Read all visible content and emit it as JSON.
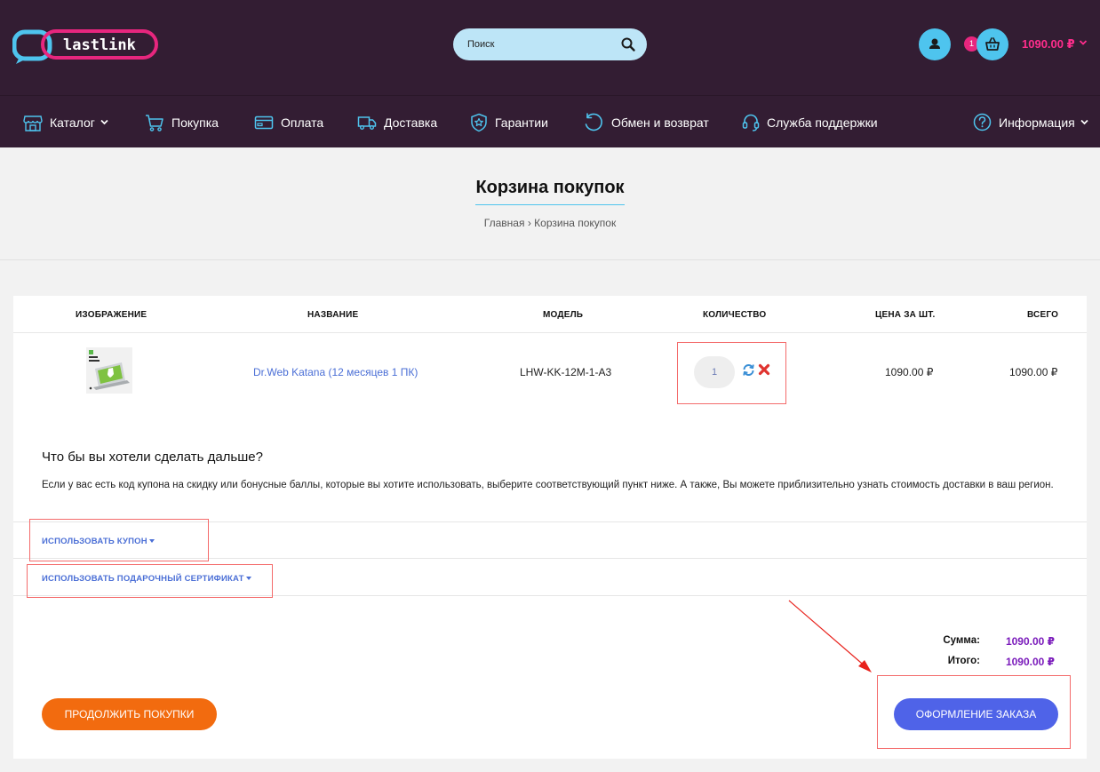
{
  "header": {
    "logo_text": "lastlink",
    "search_placeholder": "Поиск",
    "cart_count": "1",
    "cart_total": "1090.00 ₽"
  },
  "nav": [
    {
      "label": "Каталог",
      "icon": "storefront-icon",
      "has_dropdown": true
    },
    {
      "label": "Покупка",
      "icon": "cart-icon"
    },
    {
      "label": "Оплата",
      "icon": "credit-card-icon"
    },
    {
      "label": "Доставка",
      "icon": "truck-icon"
    },
    {
      "label": "Гарантии",
      "icon": "shield-star-icon"
    },
    {
      "label": "Обмен и возврат",
      "icon": "return-icon"
    },
    {
      "label": "Служба поддержки",
      "icon": "headset-icon"
    },
    {
      "label": "Информация",
      "icon": "question-icon",
      "has_dropdown": true
    }
  ],
  "page": {
    "title": "Корзина покупок",
    "breadcrumb_home": "Главная",
    "breadcrumb_sep": "›",
    "breadcrumb_current": "Корзина покупок"
  },
  "table": {
    "headers": [
      "Изображение",
      "Название",
      "Модель",
      "Количество",
      "Цена за шт.",
      "Всего"
    ],
    "rows": [
      {
        "name": "Dr.Web Katana (12 месяцев 1 ПК)",
        "model": "LHW-KK-12M-1-A3",
        "quantity": "1",
        "unit_price": "1090.00 ₽",
        "total": "1090.00 ₽"
      }
    ]
  },
  "next_steps": {
    "title": "Что бы вы хотели сделать дальше?",
    "text": "Если у вас есть код купона на скидку или бонусные баллы, которые вы хотите использовать, выберите соответствующий пункт ниже. А также, Вы можете приблизительно узнать стоимость доставки в ваш регион.",
    "coupon_label": "Использовать купон",
    "gift_label": "Использовать подарочный сертификат"
  },
  "totals": {
    "subtotal_label": "Сумма:",
    "subtotal_value": "1090.00 ₽",
    "total_label": "Итого:",
    "total_value": "1090.00 ₽"
  },
  "buttons": {
    "continue": "Продолжить покупки",
    "checkout": "Оформление заказа"
  },
  "colors": {
    "header_bg": "#331d33",
    "accent_pink": "#ff2d8c",
    "accent_cyan": "#4ec4ee",
    "link_blue": "#4b6fd6",
    "continue_orange": "#f26b0f",
    "checkout_blue": "#4f63e8",
    "total_purple": "#7a1bbb",
    "highlight_red": "#f46b6b"
  }
}
